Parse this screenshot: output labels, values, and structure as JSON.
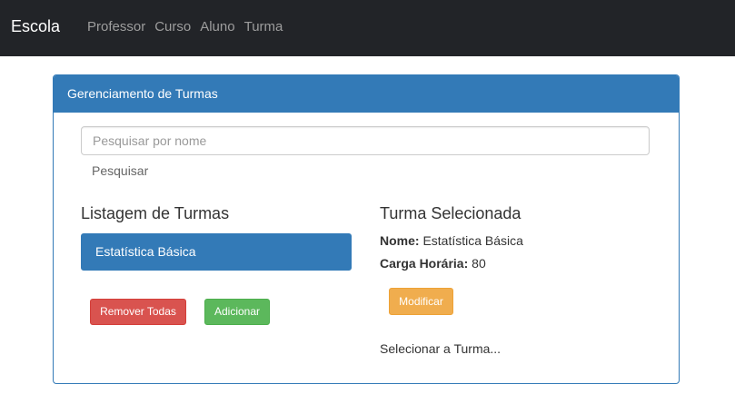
{
  "navbar": {
    "brand": "Escola",
    "links": [
      "Professor",
      "Curso",
      "Aluno",
      "Turma"
    ]
  },
  "panel": {
    "heading": "Gerenciamento de Turmas",
    "search": {
      "placeholder": "Pesquisar por nome",
      "value": "",
      "action_label": "Pesquisar"
    },
    "list": {
      "title": "Listagem de Turmas",
      "items": [
        "Estatística Básica"
      ],
      "remove_all_label": "Remover Todas",
      "add_label": "Adicionar"
    },
    "selected": {
      "title": "Turma Selecionada",
      "name_label": "Nome:",
      "name_value": "Estatística Básica",
      "hours_label": "Carga Horária:",
      "hours_value": "80",
      "modify_label": "Modificar",
      "select_label": "Selecionar a Turma..."
    }
  },
  "colors": {
    "navbar_bg": "#222428",
    "primary": "#337ab7",
    "danger": "#d9534f",
    "success": "#5cb85c",
    "warning": "#f0ad4e"
  }
}
